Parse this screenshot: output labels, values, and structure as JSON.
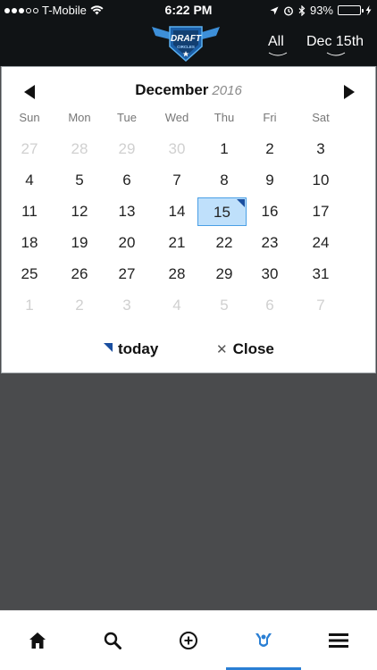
{
  "status_bar": {
    "carrier": "T-Mobile",
    "time": "6:22 PM",
    "battery": "93%"
  },
  "header": {
    "logo_top": "DRAFT",
    "logo_bottom": "CIRCLES",
    "filter_all": "All",
    "date_label": "Dec 15th"
  },
  "calendar": {
    "month": "December",
    "year": "2016",
    "weekdays": [
      "Sun",
      "Mon",
      "Tue",
      "Wed",
      "Thu",
      "Fri",
      "Sat"
    ],
    "weeks": [
      [
        "27",
        "28",
        "29",
        "30",
        "1",
        "2",
        "3"
      ],
      [
        "4",
        "5",
        "6",
        "7",
        "8",
        "9",
        "10"
      ],
      [
        "11",
        "12",
        "13",
        "14",
        "15",
        "16",
        "17"
      ],
      [
        "18",
        "19",
        "20",
        "21",
        "22",
        "23",
        "24"
      ],
      [
        "25",
        "26",
        "27",
        "28",
        "29",
        "30",
        "31"
      ],
      [
        "1",
        "2",
        "3",
        "4",
        "5",
        "6",
        "7"
      ]
    ],
    "selected_day": "15",
    "today_label": "today",
    "close_label": "Close"
  },
  "colors": {
    "header_bg": "#101315",
    "overlay_bg": "#4a4b4d",
    "selected_fill": "#bfe0fb",
    "selected_border": "#4a9fe6",
    "accent": "#1a4fa0",
    "tab_active": "#2a7fd4"
  },
  "tabs": [
    {
      "icon": "home-icon"
    },
    {
      "icon": "search-icon"
    },
    {
      "icon": "add-circle-icon"
    },
    {
      "icon": "draft-circles-icon"
    },
    {
      "icon": "menu-icon"
    }
  ]
}
